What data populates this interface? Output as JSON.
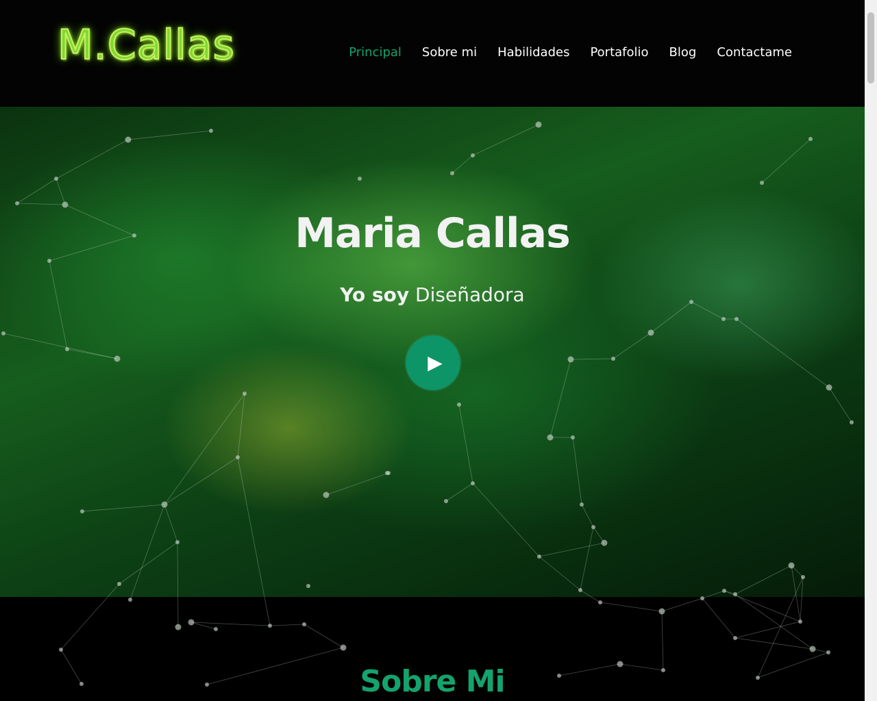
{
  "header": {
    "logo": "M.Callas",
    "nav": [
      "Principal",
      "Sobre mi",
      "Habilidades",
      "Portafolio",
      "Blog",
      "Contactame"
    ],
    "active": "Principal"
  },
  "hero": {
    "title": "Maria Callas",
    "subtitle_bold": "Yo soy",
    "subtitle_role": "Diseñadora",
    "play_icon": "play-icon"
  },
  "about": {
    "title": "Sobre Mi"
  },
  "colors": {
    "accent": "#12a36d",
    "background": "#000000"
  }
}
